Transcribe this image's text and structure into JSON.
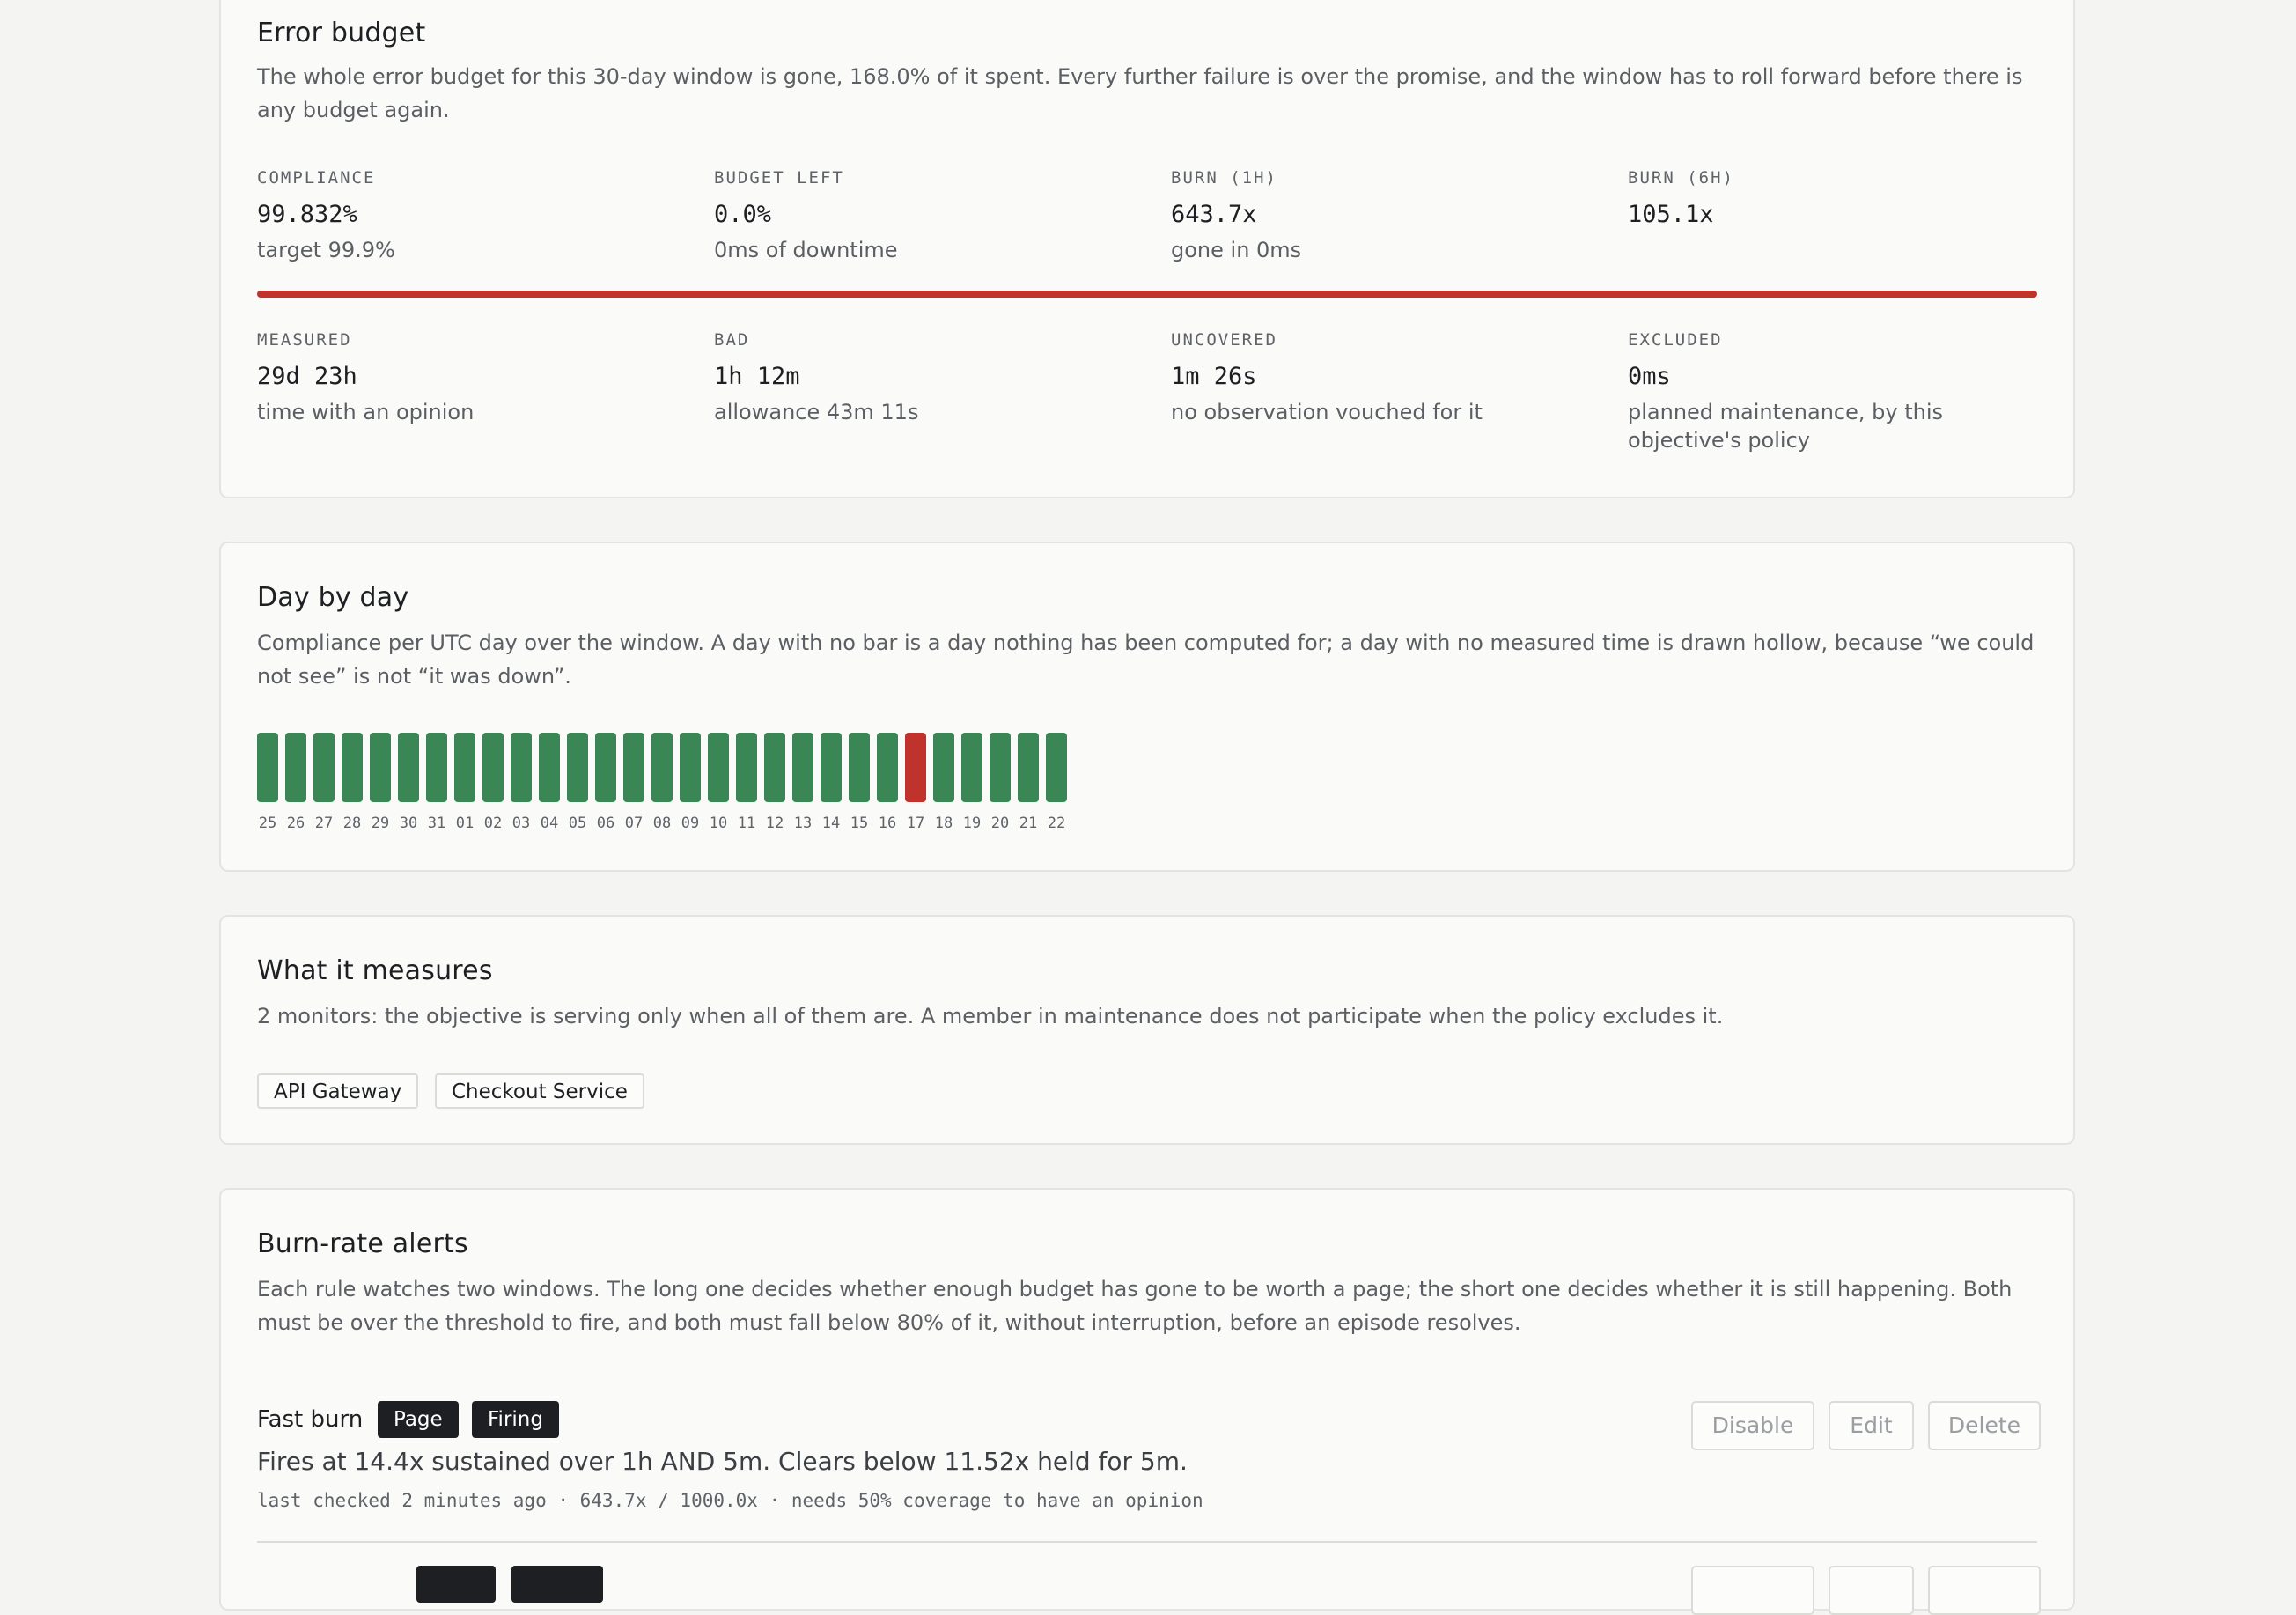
{
  "error_budget": {
    "title": "Error budget",
    "description": "The whole error budget for this 30-day window is gone, 168.0% of it spent. Every further failure is over the promise, and the window has to roll forward before there is any budget again.",
    "bar_color": "#c0322c",
    "stats_top": [
      {
        "label": "COMPLIANCE",
        "value": "99.832%",
        "sub": "target 99.9%"
      },
      {
        "label": "BUDGET LEFT",
        "value": "0.0%",
        "sub": "0ms of downtime"
      },
      {
        "label": "BURN (1H)",
        "value": "643.7x",
        "sub": "gone in 0ms"
      },
      {
        "label": "BURN (6H)",
        "value": "105.1x",
        "sub": ""
      }
    ],
    "stats_bottom": [
      {
        "label": "MEASURED",
        "value": "29d 23h",
        "sub": "time with an opinion"
      },
      {
        "label": "BAD",
        "value": "1h 12m",
        "sub": "allowance 43m 11s"
      },
      {
        "label": "UNCOVERED",
        "value": "1m 26s",
        "sub": "no observation vouched for it"
      },
      {
        "label": "EXCLUDED",
        "value": "0ms",
        "sub": "planned maintenance, by this objective's policy"
      }
    ]
  },
  "day_by_day": {
    "title": "Day by day",
    "description": "Compliance per UTC day over the window. A day with no bar is a day nothing has been computed for; a day with no measured time is drawn hollow, because “we could not see” is not “it was down”.",
    "ok_color": "#3a8654",
    "bad_color": "#c0322c",
    "days": [
      {
        "label": "25",
        "status": "ok"
      },
      {
        "label": "26",
        "status": "ok"
      },
      {
        "label": "27",
        "status": "ok"
      },
      {
        "label": "28",
        "status": "ok"
      },
      {
        "label": "29",
        "status": "ok"
      },
      {
        "label": "30",
        "status": "ok"
      },
      {
        "label": "31",
        "status": "ok"
      },
      {
        "label": "01",
        "status": "ok"
      },
      {
        "label": "02",
        "status": "ok"
      },
      {
        "label": "03",
        "status": "ok"
      },
      {
        "label": "04",
        "status": "ok"
      },
      {
        "label": "05",
        "status": "ok"
      },
      {
        "label": "06",
        "status": "ok"
      },
      {
        "label": "07",
        "status": "ok"
      },
      {
        "label": "08",
        "status": "ok"
      },
      {
        "label": "09",
        "status": "ok"
      },
      {
        "label": "10",
        "status": "ok"
      },
      {
        "label": "11",
        "status": "ok"
      },
      {
        "label": "12",
        "status": "ok"
      },
      {
        "label": "13",
        "status": "ok"
      },
      {
        "label": "14",
        "status": "ok"
      },
      {
        "label": "15",
        "status": "ok"
      },
      {
        "label": "16",
        "status": "ok"
      },
      {
        "label": "17",
        "status": "bad"
      },
      {
        "label": "18",
        "status": "ok"
      },
      {
        "label": "19",
        "status": "ok"
      },
      {
        "label": "20",
        "status": "ok"
      },
      {
        "label": "21",
        "status": "ok"
      },
      {
        "label": "22",
        "status": "ok"
      }
    ]
  },
  "measures": {
    "title": "What it measures",
    "description": "2 monitors: the objective is serving only when all of them are. A member in maintenance does not participate when the policy excludes it.",
    "monitors": [
      "API Gateway",
      "Checkout Service"
    ]
  },
  "alerts": {
    "title": "Burn-rate alerts",
    "description": "Each rule watches two windows. The long one decides whether enough budget has gone to be worth a page; the short one decides whether it is still happening. Both must be over the threshold to fire, and both must fall below 80% of it, without interruption, before an episode resolves.",
    "rules": [
      {
        "name": "Fast burn",
        "badges": [
          "Page",
          "Firing"
        ],
        "summary": "Fires at 14.4x sustained over 1h AND 5m. Clears below 11.52x held for 5m.",
        "meta": "last checked 2 minutes ago · 643.7x / 1000.0x · needs 50% coverage to have an opinion",
        "buttons": {
          "disable": "Disable",
          "edit": "Edit",
          "delete": "Delete"
        }
      }
    ]
  }
}
